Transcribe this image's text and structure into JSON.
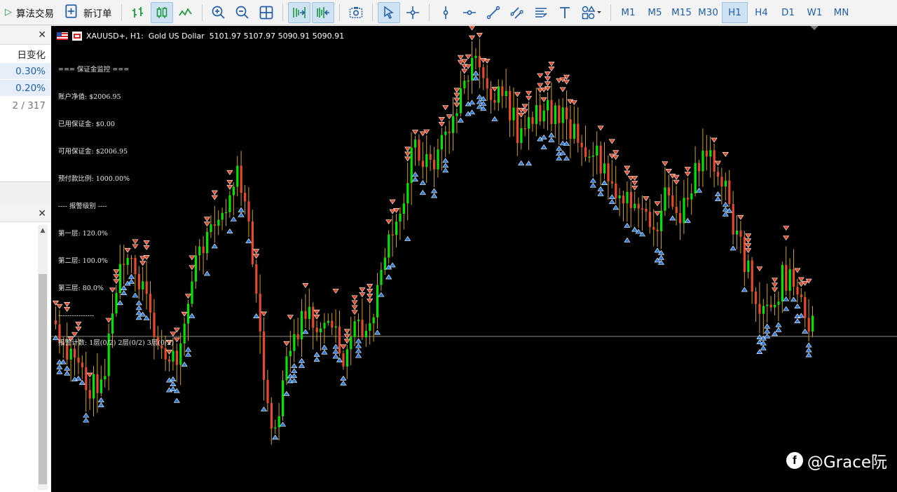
{
  "toolbar": {
    "algo_trading_label": "算法交易",
    "new_order_label": "新订单",
    "timeframes": [
      "M1",
      "M5",
      "M15",
      "M30",
      "H1",
      "H4",
      "D1",
      "W1",
      "MN"
    ],
    "active_timeframe": "H1",
    "icons": [
      "bar-chart-icon",
      "candlestick-chart-icon",
      "line-chart-icon",
      "zoom-in-icon",
      "zoom-out-icon",
      "tile-windows-icon",
      "auto-scroll-icon",
      "chart-shift-icon",
      "screenshot-icon",
      "cursor-icon",
      "crosshair-icon",
      "vertical-line-icon",
      "horizontal-line-icon",
      "trend-line-icon",
      "channel-icon",
      "fibonacci-icon",
      "text-icon",
      "shapes-icon"
    ]
  },
  "market_watch": {
    "column_header": "日变化",
    "rows": [
      "0.30%",
      "0.20%"
    ],
    "count": "2 / 317"
  },
  "chart": {
    "symbol_line": "XAUUSD+, H1:  Gold US Dollar  5101.97 5107.97 5090.91 5090.91",
    "monitor_lines": [
      "=== 保证金监控 ===",
      "账户净值: $2006.95",
      "已用保证金: $0.00",
      "可用保证金: $2006.95",
      "预付款比例: 1000.00%",
      "---- 报警级别 ----",
      "第一层: 120.0%",
      "第二层: 100.0%",
      "第三层: 80.0%",
      "----------------",
      "报警计数: 1层(0/2) 2层(0/2) 3层(0/2)"
    ],
    "watermark": "@Grace阮",
    "colors": {
      "bull": "#00e600",
      "bear": "#e8482c",
      "wick": "#d4a017",
      "buy_arrow": "#2b78d8",
      "sell_arrow": "#e04a2a",
      "bid_line": "#8a8a8a",
      "background": "#000000"
    }
  }
}
